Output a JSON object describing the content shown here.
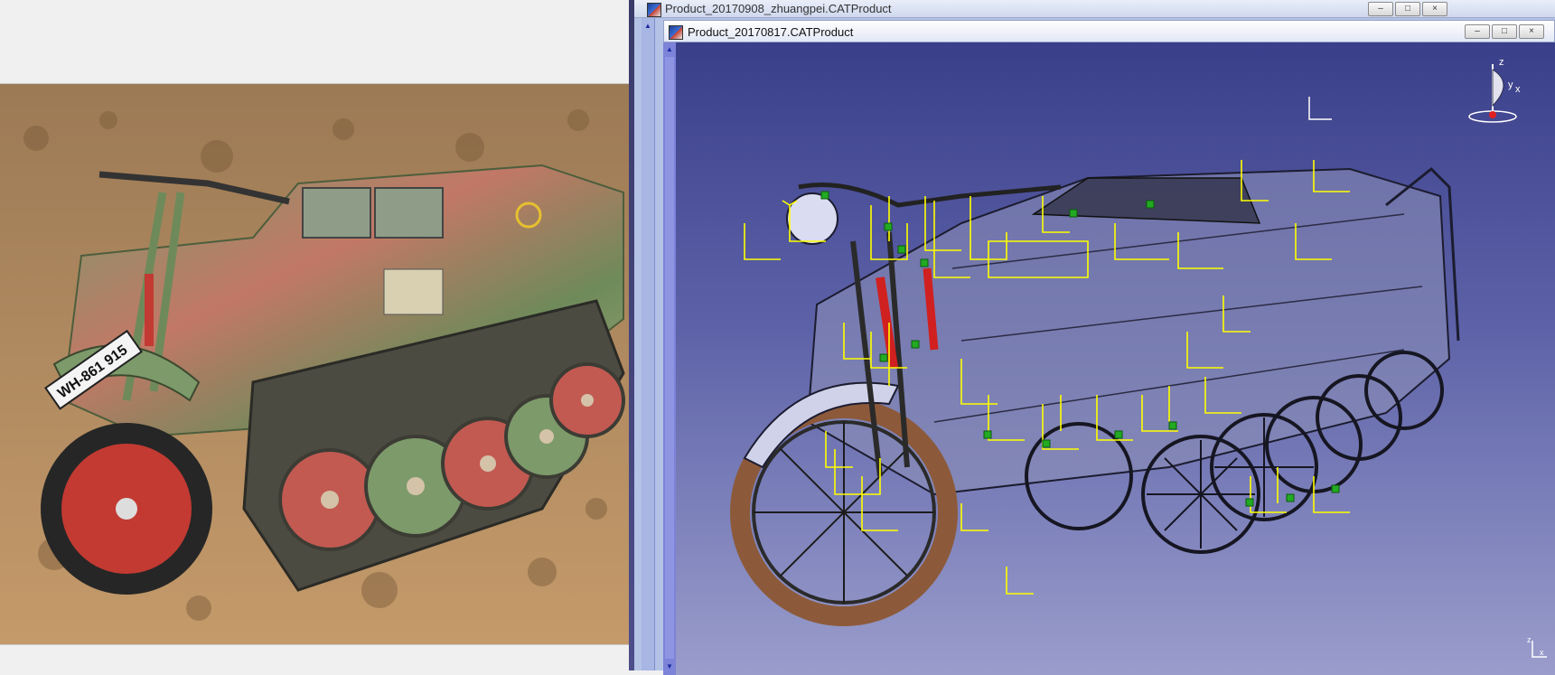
{
  "outer_window": {
    "title": "Product_20170908_zhuangpei.CATProduct",
    "controls": {
      "minimize": "–",
      "restore": "□",
      "close": "×"
    }
  },
  "inner_window": {
    "title": "Product_20170817.CATProduct",
    "controls": {
      "minimize": "–",
      "restore": "□",
      "close": "×"
    }
  },
  "photo": {
    "plate_text": "WH-861 915",
    "icons": [
      "photo-of-tracked-motorcycle"
    ]
  },
  "viewport": {
    "compass": {
      "axis_z": "z",
      "axis_y": "y",
      "axis_x": "x"
    },
    "mini_axis": {
      "axis_z": "z",
      "axis_x": "x"
    },
    "icons": [
      "compass-icon",
      "axis-triad-icon"
    ]
  },
  "colors": {
    "viewport_top": "#3a3f8a",
    "viewport_bottom": "#9a9dcb",
    "annotation_yellow": "#ffff00",
    "constraint_green": "#22aa22",
    "camouflage_green": "#6f8a5a",
    "camouflage_red": "#c26a5a"
  }
}
